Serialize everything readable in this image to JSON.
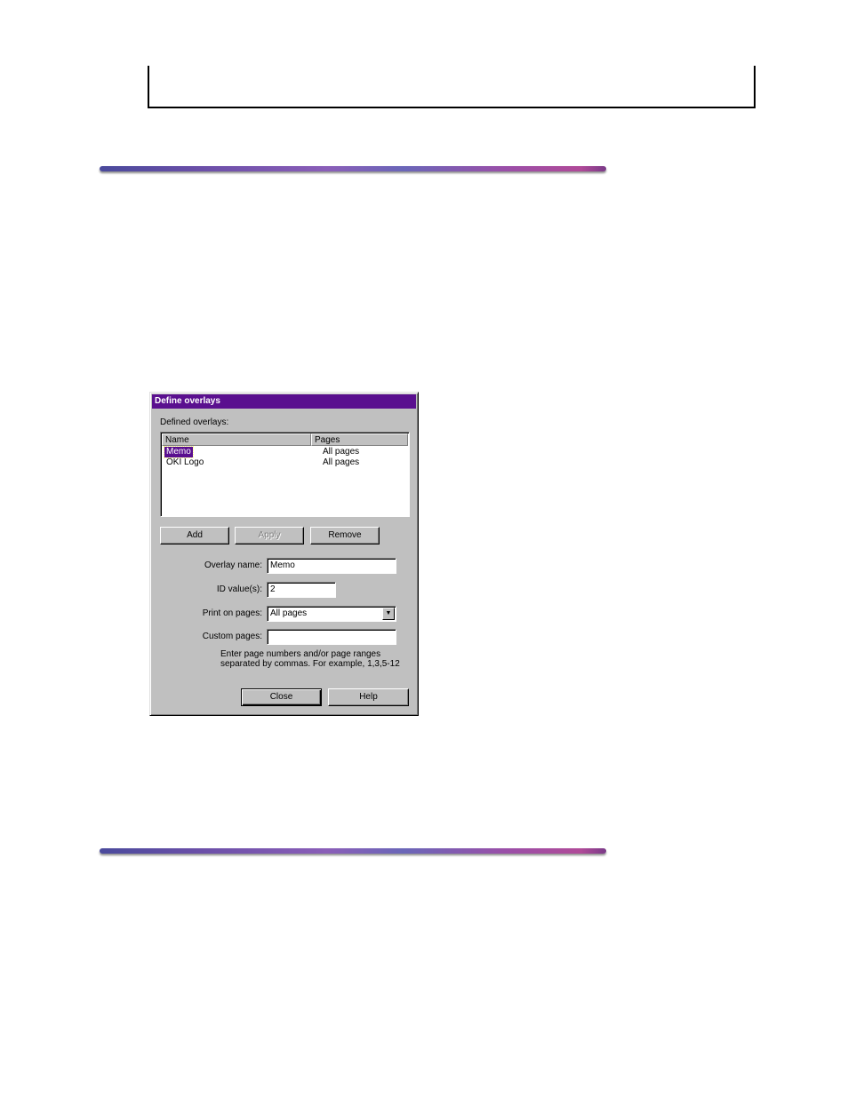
{
  "dialog": {
    "title": "Define overlays",
    "list_label": "Defined overlays:",
    "columns": {
      "name": "Name",
      "pages": "Pages"
    },
    "rows": [
      {
        "name": "Memo",
        "pages": "All pages",
        "selected": true
      },
      {
        "name": "OKI Logo",
        "pages": "All pages",
        "selected": false
      }
    ],
    "buttons": {
      "add": "Add",
      "apply": "Apply",
      "remove": "Remove",
      "close": "Close",
      "help": "Help"
    },
    "fields": {
      "overlay_name_label": "Overlay name:",
      "overlay_name_value": "Memo",
      "id_values_label": "ID value(s):",
      "id_values_value": "2",
      "print_on_pages_label": "Print on pages:",
      "print_on_pages_value": "All pages",
      "custom_pages_label": "Custom pages:",
      "custom_pages_value": ""
    },
    "hint": "Enter page numbers and/or page ranges separated by commas. For example, 1,3,5-12",
    "colors": {
      "titlebar": "#5a0f8f",
      "face": "#c0c0c0"
    }
  }
}
